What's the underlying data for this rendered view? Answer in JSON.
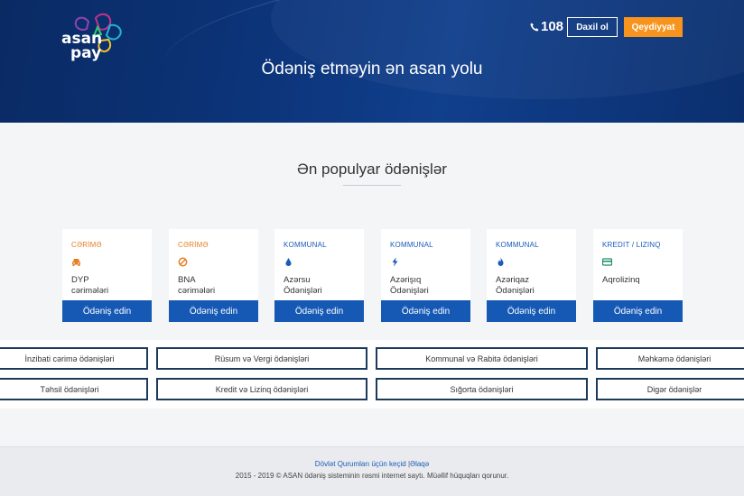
{
  "header": {
    "logo": {
      "line1": "asan",
      "line2": "pay"
    },
    "phone": "108",
    "login_label": "Daxil ol",
    "register_label": "Qeydiyyat",
    "hero_title": "Ödəniş etməyin ən asan yolu",
    "colors": {
      "accent": "#f7941d",
      "hero": "#0c3479"
    }
  },
  "popular": {
    "title": "Ən populyar ödənişlər",
    "cards": [
      {
        "category": "CƏRİMƏ",
        "name_line1": "DYP",
        "name_line2": "cərimələri",
        "icon": "car-icon",
        "pay_label": "Ödəniş edin"
      },
      {
        "category": "CƏRİMƏ",
        "name_line1": "BNA",
        "name_line2": "cərimələri",
        "icon": "prohibited-icon",
        "pay_label": "Ödəniş edin"
      },
      {
        "category": "KOMMUNAL",
        "name_line1": "Azərsu",
        "name_line2": "Ödənişləri",
        "icon": "water-drop-icon",
        "pay_label": "Ödəniş edin"
      },
      {
        "category": "KOMMUNAL",
        "name_line1": "Azərişıq",
        "name_line2": "Ödənişləri",
        "icon": "lightning-icon",
        "pay_label": "Ödəniş edin"
      },
      {
        "category": "KOMMUNAL",
        "name_line1": "Azəriqaz",
        "name_line2": "Ödənişləri",
        "icon": "gas-flame-icon",
        "pay_label": "Ödəniş edin"
      },
      {
        "category": "KREDIT / LIZINQ",
        "name_line1": "Aqrolizinq",
        "name_line2": "",
        "icon": "credit-card-icon",
        "pay_label": "Ödəniş edin"
      }
    ]
  },
  "categories": [
    "İnzibati cərimə ödənişləri",
    "Rüsum və Vergi ödənişləri",
    "Kommunal və Rabitə ödənişləri",
    "Məhkəmə ödənişləri",
    "Təhsil ödənişləri",
    "Kredit və Lizinq ödənişləri",
    "Sığorta ödənişləri",
    "Digər ödənişlər"
  ],
  "footer": {
    "link1": "Dövlət Qurumları üçün keçid",
    "sep": "|",
    "link2": "Əlaqə",
    "copyright": "2015 - 2019 © ASAN ödəniş sisteminin rəsmi internet saytı. Müəllif hüquqları qorunur."
  }
}
